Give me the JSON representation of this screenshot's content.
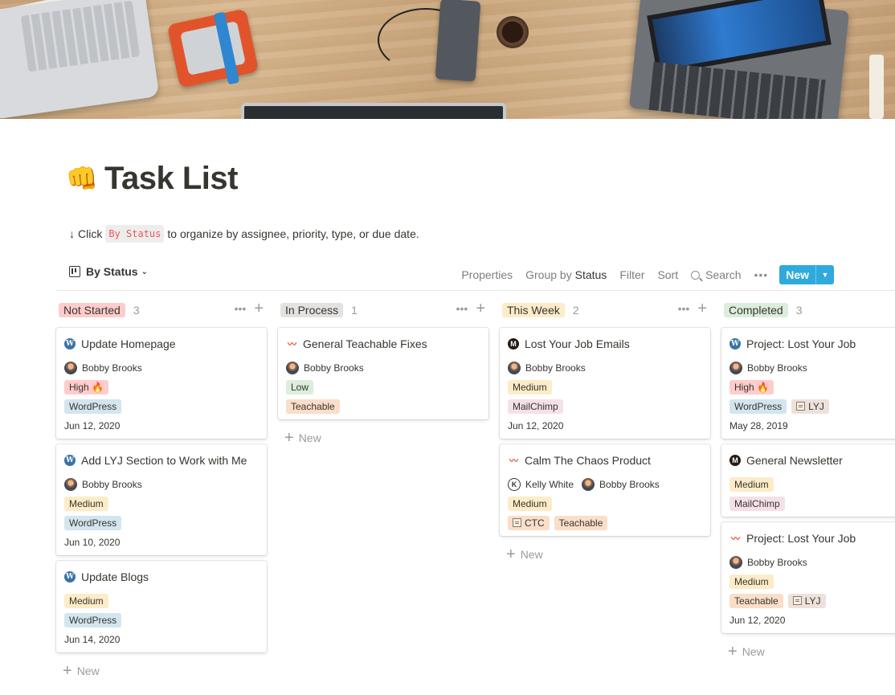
{
  "page": {
    "title_emoji": "👊",
    "title": "Task List",
    "description": {
      "arrow": "↓",
      "before": "Click",
      "code": "By Status",
      "after": "to organize by assignee, priority, type, or due date."
    }
  },
  "toolbar": {
    "view_name": "By Status",
    "view_chevron": "⌄",
    "properties": "Properties",
    "group_by_label": "Group by",
    "group_by_value": "Status",
    "filter": "Filter",
    "sort": "Sort",
    "search": "Search",
    "more": "•••",
    "new_label": "New",
    "new_dropdown": "▼"
  },
  "board": {
    "new_label": "New",
    "add_symbol": "+",
    "more_symbol": "•••",
    "columns": [
      {
        "name": "Not Started",
        "color": "#ffcccc",
        "count": "3",
        "cards": [
          {
            "icon": "wordpress-icon",
            "title": "Update Homepage",
            "assignees": [
              "Bobby Brooks"
            ],
            "priority": "High 🔥",
            "tags": [
              "WordPress"
            ],
            "date": "Jun 12, 2020"
          },
          {
            "icon": "wordpress-icon",
            "title": "Add LYJ Section to Work with Me",
            "assignees": [
              "Bobby Brooks"
            ],
            "priority": "Medium",
            "tags": [
              "WordPress"
            ],
            "date": "Jun 10, 2020"
          },
          {
            "icon": "wordpress-icon",
            "title": "Update Blogs",
            "assignees": [],
            "priority": "Medium",
            "tags": [
              "WordPress"
            ],
            "date": "Jun 14, 2020"
          }
        ]
      },
      {
        "name": "In Process",
        "color": "#e3e2e0",
        "count": "1",
        "cards": [
          {
            "icon": "teachable-icon",
            "title": "General Teachable Fixes",
            "assignees": [
              "Bobby Brooks"
            ],
            "priority": "Low",
            "tags": [
              "Teachable"
            ],
            "date": ""
          }
        ]
      },
      {
        "name": "This Week",
        "color": "#fdecc8",
        "count": "2",
        "cards": [
          {
            "icon": "mailchimp-icon",
            "title": "Lost Your Job Emails",
            "assignees": [
              "Bobby Brooks"
            ],
            "priority": "Medium",
            "tags": [
              "MailChimp"
            ],
            "date": "Jun 12, 2020"
          },
          {
            "icon": "teachable-icon",
            "title": "Calm The Chaos Product",
            "assignees": [
              "Kelly White",
              "Bobby Brooks"
            ],
            "priority": "Medium",
            "tags": [
              "CTC",
              "Teachable"
            ],
            "date": ""
          }
        ]
      },
      {
        "name": "Completed",
        "color": "#dbeddb",
        "count": "3",
        "cards": [
          {
            "icon": "wordpress-icon",
            "title": "Project: Lost Your Job",
            "assignees": [
              "Bobby Brooks"
            ],
            "priority": "High 🔥",
            "tags": [
              "WordPress",
              "LYJ"
            ],
            "date": "May 28, 2019"
          },
          {
            "icon": "mailchimp-icon",
            "title": "General Newsletter",
            "assignees": [],
            "priority": "Medium",
            "tags": [
              "MailChimp"
            ],
            "date": ""
          },
          {
            "icon": "teachable-icon",
            "title": "Project: Lost Your Job",
            "assignees": [
              "Bobby Brooks"
            ],
            "priority": "Medium",
            "tags": [
              "Teachable",
              "LYJ"
            ],
            "date": "Jun 12, 2020"
          }
        ]
      }
    ]
  }
}
